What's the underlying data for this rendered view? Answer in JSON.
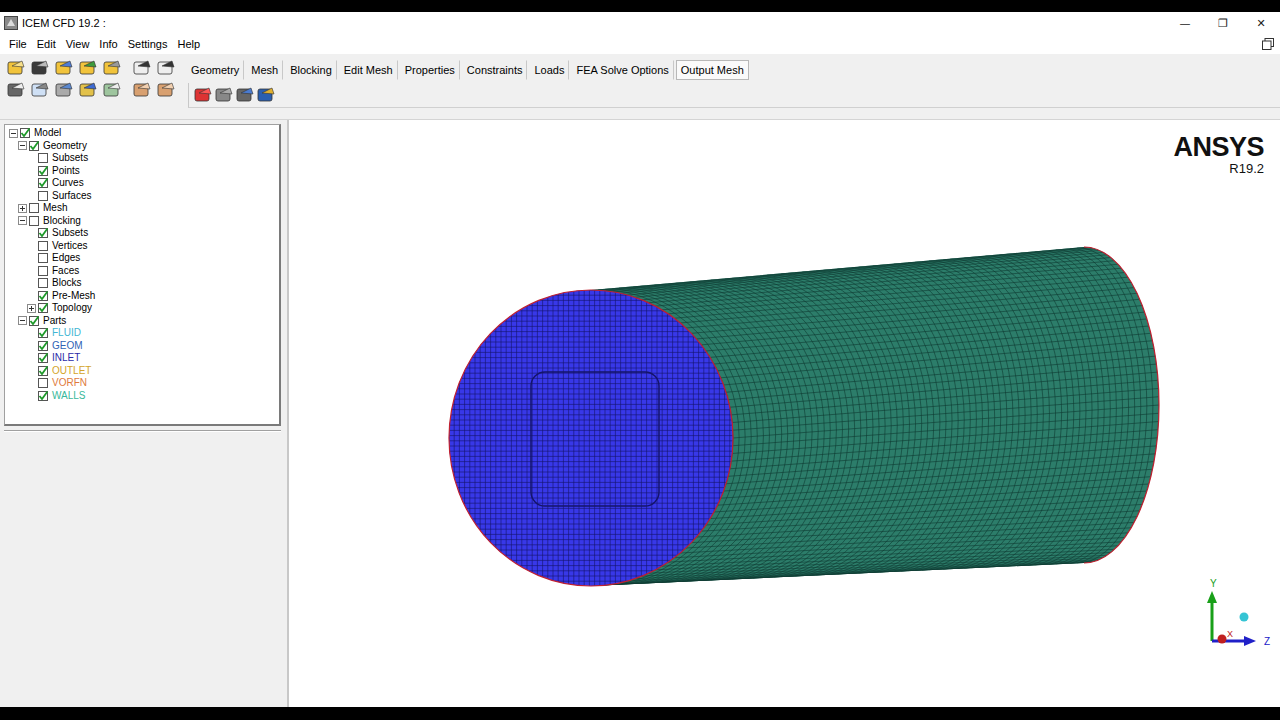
{
  "window": {
    "title": "ICEM CFD 19.2 :",
    "controls": [
      "—",
      "❐",
      "✕"
    ]
  },
  "menu": [
    "File",
    "Edit",
    "View",
    "Info",
    "Settings",
    "Help"
  ],
  "tabs": [
    {
      "label": "Geometry",
      "selected": false
    },
    {
      "label": "Mesh",
      "selected": false
    },
    {
      "label": "Blocking",
      "selected": false
    },
    {
      "label": "Edit Mesh",
      "selected": false
    },
    {
      "label": "Properties",
      "selected": false
    },
    {
      "label": "Constraints",
      "selected": false
    },
    {
      "label": "Loads",
      "selected": false
    },
    {
      "label": "FEA Solve Options",
      "selected": false
    },
    {
      "label": "Output Mesh",
      "selected": true
    }
  ],
  "tree": [
    {
      "label": "Model",
      "depth": 0,
      "checked": true,
      "expandable": true,
      "expanded": true
    },
    {
      "label": "Geometry",
      "depth": 1,
      "checked": true,
      "expandable": true,
      "expanded": true
    },
    {
      "label": "Subsets",
      "depth": 2,
      "checked": false,
      "expandable": false,
      "expanded": false
    },
    {
      "label": "Points",
      "depth": 2,
      "checked": true,
      "expandable": false,
      "expanded": false
    },
    {
      "label": "Curves",
      "depth": 2,
      "checked": true,
      "expandable": false,
      "expanded": false
    },
    {
      "label": "Surfaces",
      "depth": 2,
      "checked": false,
      "expandable": false,
      "expanded": false
    },
    {
      "label": "Mesh",
      "depth": 1,
      "checked": false,
      "expandable": true,
      "expanded": false
    },
    {
      "label": "Blocking",
      "depth": 1,
      "checked": false,
      "expandable": true,
      "expanded": true
    },
    {
      "label": "Subsets",
      "depth": 2,
      "checked": true,
      "expandable": false,
      "expanded": false
    },
    {
      "label": "Vertices",
      "depth": 2,
      "checked": false,
      "expandable": false,
      "expanded": false
    },
    {
      "label": "Edges",
      "depth": 2,
      "checked": false,
      "expandable": false,
      "expanded": false
    },
    {
      "label": "Faces",
      "depth": 2,
      "checked": false,
      "expandable": false,
      "expanded": false
    },
    {
      "label": "Blocks",
      "depth": 2,
      "checked": false,
      "expandable": false,
      "expanded": false
    },
    {
      "label": "Pre-Mesh",
      "depth": 2,
      "checked": true,
      "expandable": false,
      "expanded": false
    },
    {
      "label": "Topology",
      "depth": 2,
      "checked": true,
      "expandable": true,
      "expanded": false
    },
    {
      "label": "Parts",
      "depth": 1,
      "checked": true,
      "expandable": true,
      "expanded": true
    },
    {
      "label": "FLUID",
      "depth": 2,
      "checked": true,
      "expandable": false,
      "expanded": false,
      "color": "#3fb6d3"
    },
    {
      "label": "GEOM",
      "depth": 2,
      "checked": true,
      "expandable": false,
      "expanded": false,
      "color": "#2f63b5"
    },
    {
      "label": "INLET",
      "depth": 2,
      "checked": true,
      "expandable": false,
      "expanded": false,
      "color": "#2b2ba8"
    },
    {
      "label": "OUTLET",
      "depth": 2,
      "checked": true,
      "expandable": false,
      "expanded": false,
      "color": "#d4a52a"
    },
    {
      "label": "VORFN",
      "depth": 2,
      "checked": false,
      "expandable": false,
      "expanded": false,
      "color": "#e07a3c"
    },
    {
      "label": "WALLS",
      "depth": 2,
      "checked": true,
      "expandable": false,
      "expanded": false,
      "color": "#38b89a"
    }
  ],
  "viewport": {
    "logo": "ANSYS",
    "version": "R19.2"
  },
  "axes": {
    "y": "Y",
    "x": "X",
    "z": "Z"
  }
}
